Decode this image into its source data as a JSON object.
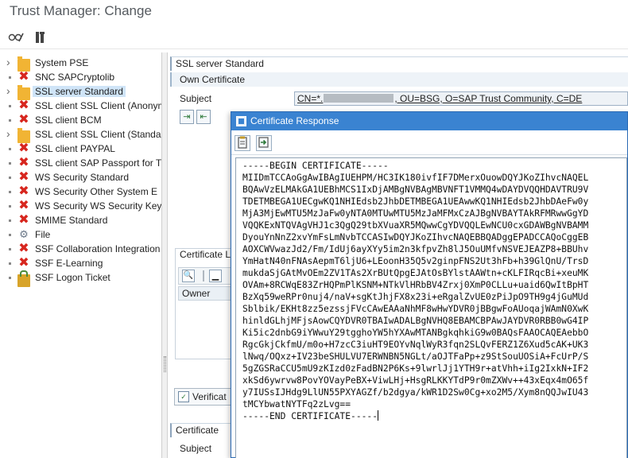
{
  "window": {
    "title": "Trust Manager: Change"
  },
  "toolbar": {
    "icons": [
      "glasses-pencil-icon",
      "tools-icon"
    ]
  },
  "tree": {
    "items": [
      {
        "label": "System PSE",
        "icon": "folder-icon",
        "expandable": true
      },
      {
        "label": "SNC SAPCryptolib",
        "icon": "error-x-icon",
        "expandable": false
      },
      {
        "label": "SSL server Standard",
        "icon": "folder-icon",
        "expandable": true,
        "selected": true
      },
      {
        "label": "SSL client SSL Client (Anonymous)",
        "icon": "error-x-icon",
        "expandable": false
      },
      {
        "label": "SSL client BCM",
        "icon": "error-x-icon",
        "expandable": false
      },
      {
        "label": "SSL client SSL Client (Standard)",
        "icon": "folder-icon",
        "expandable": true
      },
      {
        "label": "SSL client PAYPAL",
        "icon": "error-x-icon",
        "expandable": false
      },
      {
        "label": "SSL client SAP Passport for T",
        "icon": "error-x-icon",
        "expandable": false
      },
      {
        "label": "WS Security Standard",
        "icon": "error-x-icon",
        "expandable": false
      },
      {
        "label": "WS Security Other System E",
        "icon": "error-x-icon",
        "expandable": false
      },
      {
        "label": "WS Security WS Security Key",
        "icon": "error-x-icon",
        "expandable": false
      },
      {
        "label": "SMIME Standard",
        "icon": "error-x-icon",
        "expandable": false
      },
      {
        "label": "File",
        "icon": "gear-icon",
        "expandable": false
      },
      {
        "label": "SSF Collaboration Integration",
        "icon": "error-x-icon",
        "expandable": false
      },
      {
        "label": "SSF E-Learning",
        "icon": "error-x-icon",
        "expandable": false
      },
      {
        "label": "SSF Logon Ticket",
        "icon": "lock-icon",
        "expandable": false
      }
    ]
  },
  "main": {
    "section_title": "SSL server Standard",
    "own_certificate_label": "Own Certificate",
    "subject_label": "Subject",
    "subject_prefix": "CN=*.",
    "subject_suffix": ", OU=BSG, O=SAP Trust Community, C=DE",
    "certificate_list_label": "Certificate L",
    "owner_column": "Owner",
    "verify_button": "Verificat",
    "certificate_section": "Certificate",
    "subject_label_2": "Subject"
  },
  "dialog": {
    "title": "Certificate Response",
    "certificate_lines": [
      "-----BEGIN CERTIFICATE-----",
      "MIIDmTCCAoGgAwIBAgIUEHPM/HC3IK180ivfIF7DMerxOuowDQYJKoZIhvcNAQEL",
      "BQAwVzELMAkGA1UEBhMCS1IxDjAMBgNVBAgMBVNFT1VMMQ4wDAYDVQQHDAVTRU9V",
      "TDETMBEGA1UECgwKQ1NHIEdsb2JhbDETMBEGA1UEAwwKQ1NHIEdsb2JhbDAeFw0y",
      "MjA3MjEwMTU5MzJaFw0yNTA0MTUwMTU5MzJaMFMxCzAJBgNVBAYTAkRFMRwwGgYD",
      "VQQKExNTQVAgVHJ1c3QgQ29tbXVuaXR5MQwwCgYDVQQLEwNCU0cxGDAWBgNVBAMM",
      "DyouYnNnZ2xvYmFsLmNvbTCCASIwDQYJKoZIhvcNAQEBBQADggEPADCCAQoCggEB",
      "AOXCWVwazJd2/Fm/IdUj6ayXYy5im2n3kfpvZh8lJ5OuUMfvNSVEJEAZP8+BBUhv",
      "YmHatN40nFNAsAepmT6ljU6+LEoonH35Q5v2ginpFNS2Ut3hFb+h39GlQnU/TrsD",
      "mukdaSjGAtMvOEm2ZV1TAs2XrBUtQpgEJAtOsBYlstAAWtn+cKLFIRqcBi+xeuMK",
      "OVAm+8RCWqE83ZrHQPmPlKSNM+NTkVlHRbBV4Zrxj0XmP0CLLu+uaid6QwItBpHT",
      "BzXq59weRPr0nuj4/naV+sgKtJhjFX8x23i+eRgalZvUE0zPiJpO9TH9g4jGuMUd",
      "Sblbik/EKHt8zz5ezssjFVcCAwEAAaNhMF8wHwYDVR0jBBgwFoAUoqajWAmN0XwK",
      "hinldGLhjMFjsAowCQYDVR0TBAIwADALBgNVHQ8EBAMCBPAwJAYDVR0RBB0wG4IP",
      "Ki5ic2dnbG9iYWwuY29tgghoYW5hYXAwMTANBgkqhkiG9w0BAQsFAAOCAQEAebbO",
      "RgcGkjCkfmU/m0o+H7zcC3iuHT9EOYvNqlWyR3fqn2SLQvFERZ1Z6Xud5cAK+UK3",
      "lNwq/OQxz+IV23beSHULVU7ERWNBN5NGLt/aOJTFaPp+z9StSouUOSiA+FcUrP/S",
      "5gZGSRaCCU5mU9zKIzd0zFadBN2P6Ks+9lwrlJj1YTH9r+atVhh+iIg2IxkN+IF2",
      "xkSd6ywrvw8PovYOVayPeBX+ViwLHj+HsgRLKKYTdP9r0mZXWv++43xEqx4mO65f",
      "y7IUSsIJHdg9LlUN55PXYAGZf/b2dgya/kWR1D2Sw0Cg+xo2M5/Xym8nQQJwIU43",
      "tMCYbwatNYTFq2zLvg==",
      "-----END CERTIFICATE-----"
    ]
  }
}
